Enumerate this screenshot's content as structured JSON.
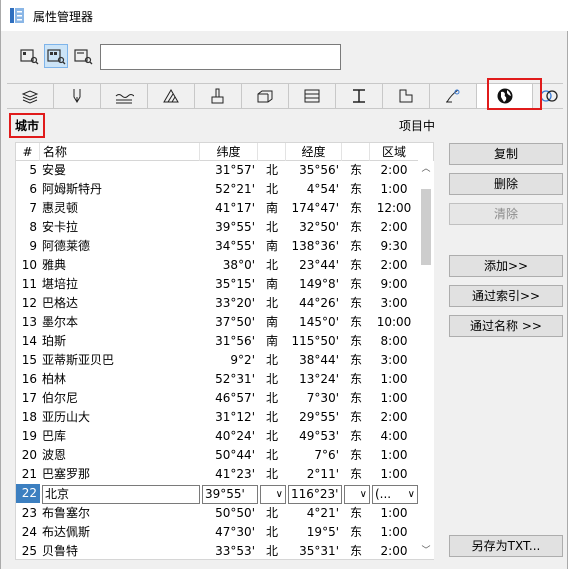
{
  "window": {
    "title": "属性管理器"
  },
  "toolbar": {
    "search_value": ""
  },
  "tabs": [
    {
      "icon": "layers-icon"
    },
    {
      "icon": "pen-icon"
    },
    {
      "icon": "line-type-icon"
    },
    {
      "icon": "fill-icon"
    },
    {
      "icon": "surface-brush-icon"
    },
    {
      "icon": "building-material-icon"
    },
    {
      "icon": "profile-icon"
    },
    {
      "icon": "beam-icon"
    },
    {
      "icon": "zone-category-icon"
    },
    {
      "icon": "renovation-icon"
    },
    {
      "icon": "globe-icon"
    },
    {
      "icon": "link-icon"
    }
  ],
  "section": {
    "label": "城市",
    "right_label": "项目中"
  },
  "table": {
    "headers": [
      "#",
      "名称",
      "纬度",
      "",
      "经度",
      "",
      "区域"
    ],
    "rows": [
      {
        "num": "5",
        "name": "安曼",
        "lat": "31°57'",
        "ns": "北",
        "lon": "35°56'",
        "ew": "东",
        "tz": "2:00"
      },
      {
        "num": "6",
        "name": "阿姆斯特丹",
        "lat": "52°21'",
        "ns": "北",
        "lon": "4°54'",
        "ew": "东",
        "tz": "1:00"
      },
      {
        "num": "7",
        "name": "惠灵顿",
        "lat": "41°17'",
        "ns": "南",
        "lon": "174°47'",
        "ew": "东",
        "tz": "12:00"
      },
      {
        "num": "8",
        "name": "安卡拉",
        "lat": "39°55'",
        "ns": "北",
        "lon": "32°50'",
        "ew": "东",
        "tz": "2:00"
      },
      {
        "num": "9",
        "name": "阿德莱德",
        "lat": "34°55'",
        "ns": "南",
        "lon": "138°36'",
        "ew": "东",
        "tz": "9:30"
      },
      {
        "num": "10",
        "name": "雅典",
        "lat": "38°0'",
        "ns": "北",
        "lon": "23°44'",
        "ew": "东",
        "tz": "2:00"
      },
      {
        "num": "11",
        "name": "堪培拉",
        "lat": "35°15'",
        "ns": "南",
        "lon": "149°8'",
        "ew": "东",
        "tz": "9:00"
      },
      {
        "num": "12",
        "name": "巴格达",
        "lat": "33°20'",
        "ns": "北",
        "lon": "44°26'",
        "ew": "东",
        "tz": "3:00"
      },
      {
        "num": "13",
        "name": "墨尔本",
        "lat": "37°50'",
        "ns": "南",
        "lon": "145°0'",
        "ew": "东",
        "tz": "10:00"
      },
      {
        "num": "14",
        "name": "珀斯",
        "lat": "31°56'",
        "ns": "南",
        "lon": "115°50'",
        "ew": "东",
        "tz": "8:00"
      },
      {
        "num": "15",
        "name": "亚蒂斯亚贝巴",
        "lat": "9°2'",
        "ns": "北",
        "lon": "38°44'",
        "ew": "东",
        "tz": "3:00"
      },
      {
        "num": "16",
        "name": "柏林",
        "lat": "52°31'",
        "ns": "北",
        "lon": "13°24'",
        "ew": "东",
        "tz": "1:00"
      },
      {
        "num": "17",
        "name": "伯尔尼",
        "lat": "46°57'",
        "ns": "北",
        "lon": "7°30'",
        "ew": "东",
        "tz": "1:00"
      },
      {
        "num": "18",
        "name": "亚历山大",
        "lat": "31°12'",
        "ns": "北",
        "lon": "29°55'",
        "ew": "东",
        "tz": "2:00"
      },
      {
        "num": "19",
        "name": "巴库",
        "lat": "40°24'",
        "ns": "北",
        "lon": "49°53'",
        "ew": "东",
        "tz": "4:00"
      },
      {
        "num": "20",
        "name": "波恩",
        "lat": "50°44'",
        "ns": "北",
        "lon": "7°6'",
        "ew": "东",
        "tz": "1:00"
      },
      {
        "num": "21",
        "name": "巴塞罗那",
        "lat": "41°23'",
        "ns": "北",
        "lon": "2°11'",
        "ew": "东",
        "tz": "1:00"
      }
    ],
    "edit_row": {
      "num": "22",
      "name": "北京",
      "lat": "39°55'",
      "ns": "",
      "lon": "116°23'",
      "ew": "",
      "tz": "(..."
    },
    "rows_after": [
      {
        "num": "23",
        "name": "布鲁塞尔",
        "lat": "50°50'",
        "ns": "北",
        "lon": "4°21'",
        "ew": "东",
        "tz": "1:00"
      },
      {
        "num": "24",
        "name": "布达佩斯",
        "lat": "47°30'",
        "ns": "北",
        "lon": "19°5'",
        "ew": "东",
        "tz": "1:00"
      },
      {
        "num": "25",
        "name": "贝鲁特",
        "lat": "33°53'",
        "ns": "北",
        "lon": "35°31'",
        "ew": "东",
        "tz": "2:00"
      }
    ]
  },
  "buttons": {
    "copy": "复制",
    "delete": "删除",
    "clear": "清除",
    "add": "添加>>",
    "by_index": "通过索引>>",
    "by_name": "通过名称 >>",
    "save_txt": "另存为TXT..."
  }
}
